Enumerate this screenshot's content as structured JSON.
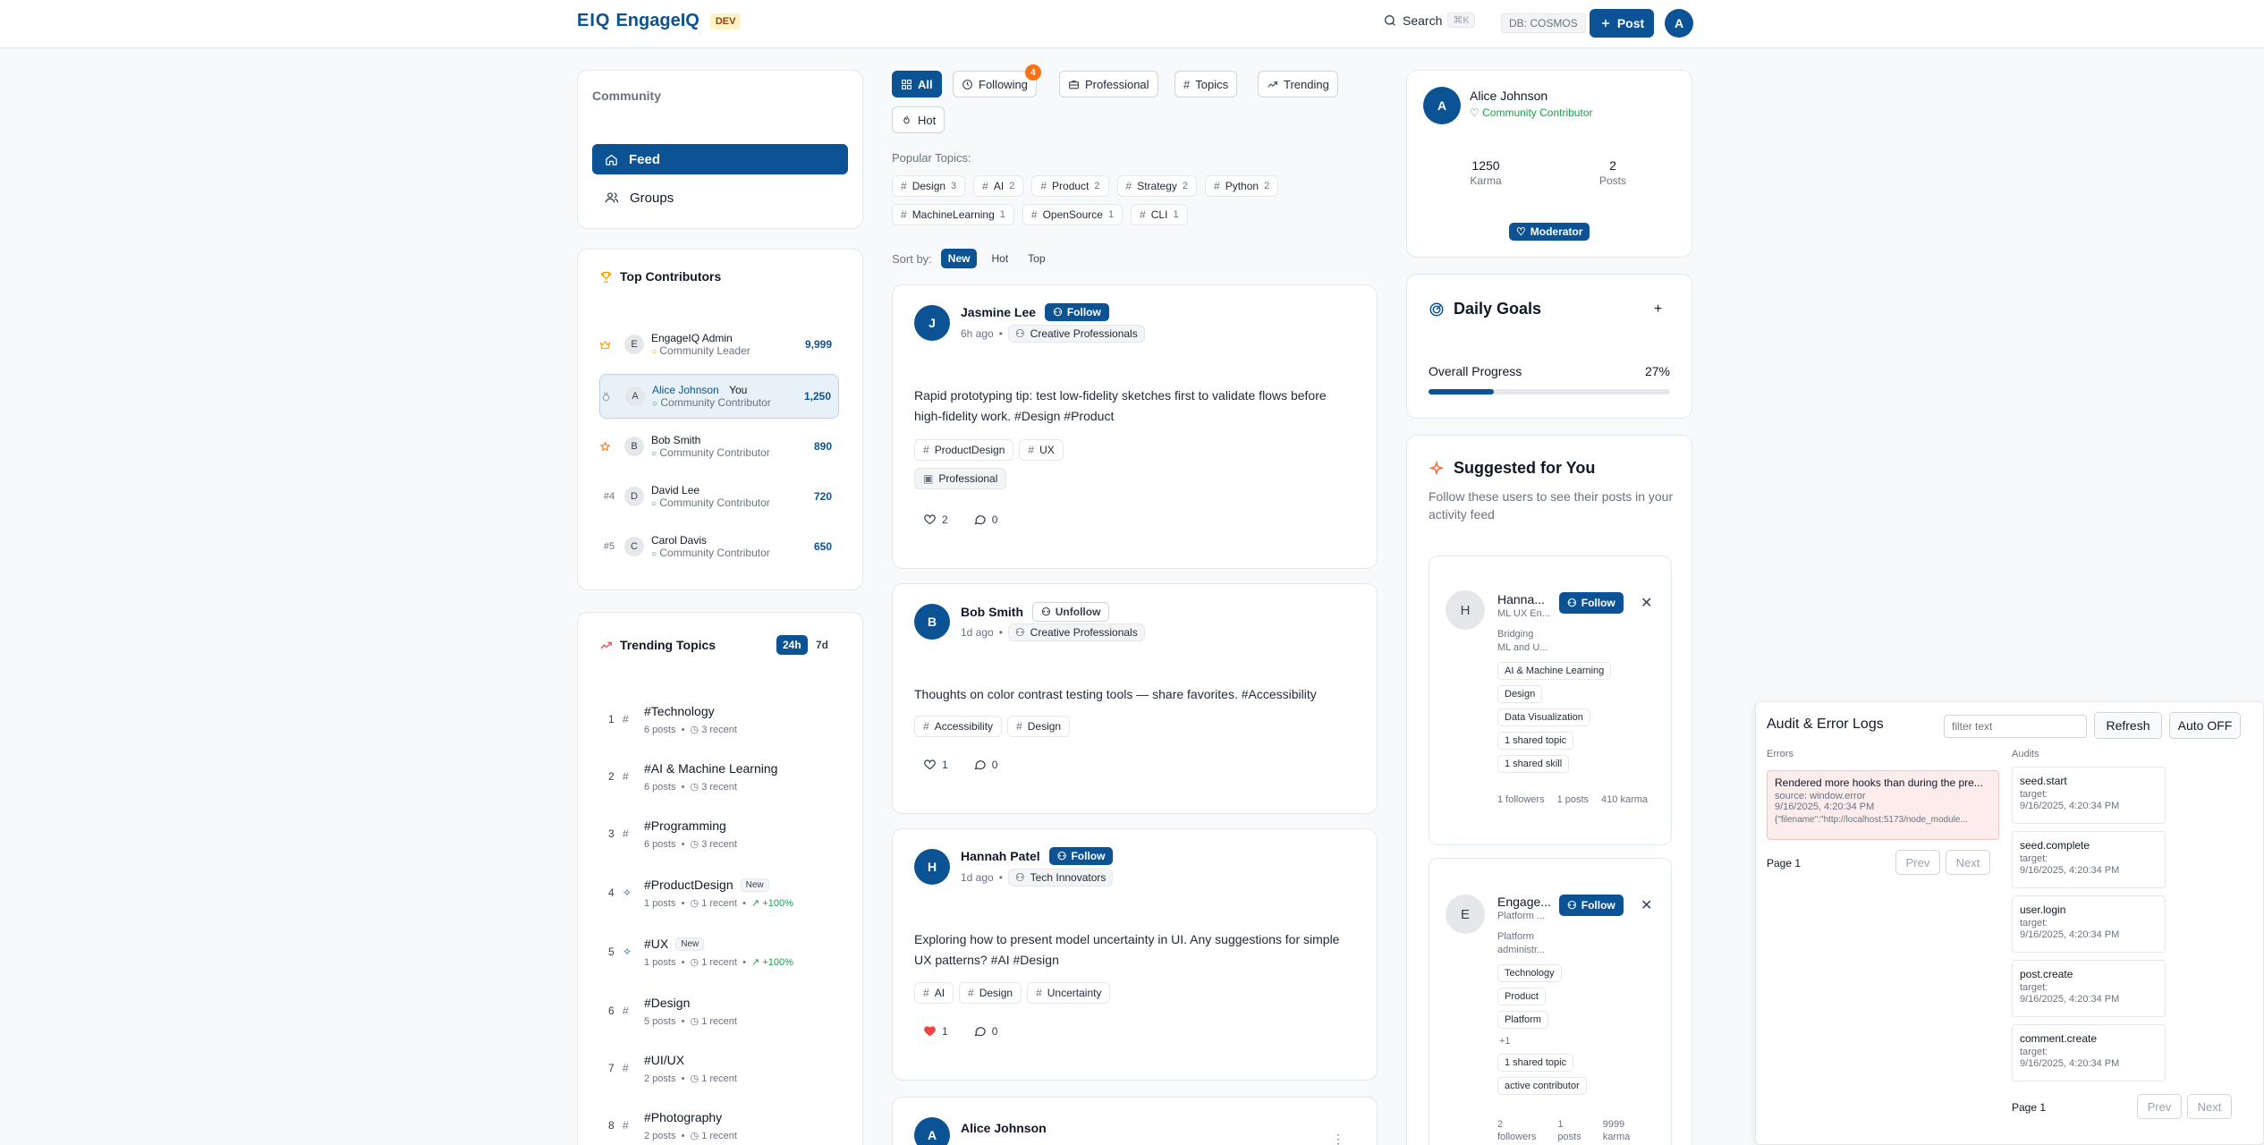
{
  "header": {
    "logo_mark": "EIQ",
    "logo_text": "EngageIQ",
    "env_badge": "DEV",
    "search_label": "Search",
    "search_shortcut": "⌘K",
    "db_tag": "DB: COSMOS",
    "post_label": "Post",
    "avatar_initial": "A"
  },
  "sidebar": {
    "section_title": "Community",
    "nav": [
      {
        "label": "Feed",
        "icon": "home-icon",
        "active": true
      },
      {
        "label": "Groups",
        "icon": "users-icon",
        "active": false
      }
    ]
  },
  "top_contributors": {
    "title": "Top Contributors",
    "items": [
      {
        "rank": "",
        "rank_icon": "crown-icon",
        "initial": "E",
        "name": "EngageIQ Admin",
        "you": "",
        "role": "Community Leader",
        "score": "9,999"
      },
      {
        "rank": "",
        "rank_icon": "medal-icon",
        "initial": "A",
        "name": "Alice Johnson",
        "you": "You",
        "role": "Community Contributor",
        "score": "1,250"
      },
      {
        "rank": "",
        "rank_icon": "award-icon",
        "initial": "B",
        "name": "Bob Smith",
        "you": "",
        "role": "Community Contributor",
        "score": "890"
      },
      {
        "rank": "#4",
        "rank_icon": "",
        "initial": "D",
        "name": "David Lee",
        "you": "",
        "role": "Community Contributor",
        "score": "720"
      },
      {
        "rank": "#5",
        "rank_icon": "",
        "initial": "C",
        "name": "Carol Davis",
        "you": "",
        "role": "Community Contributor",
        "score": "650"
      }
    ]
  },
  "trending": {
    "title": "Trending Topics",
    "range_active": "24h",
    "range_other": "7d",
    "items": [
      {
        "num": "1",
        "title": "#Technology",
        "badge": "",
        "posts": "6 posts",
        "recent": "3 recent",
        "growth": ""
      },
      {
        "num": "2",
        "title": "#AI & Machine Learning",
        "badge": "",
        "posts": "6 posts",
        "recent": "3 recent",
        "growth": ""
      },
      {
        "num": "3",
        "title": "#Programming",
        "badge": "",
        "posts": "6 posts",
        "recent": "3 recent",
        "growth": ""
      },
      {
        "num": "4",
        "title": "#ProductDesign",
        "badge": "New",
        "posts": "1 posts",
        "recent": "1 recent",
        "growth": "+100%"
      },
      {
        "num": "5",
        "title": "#UX",
        "badge": "New",
        "posts": "1 posts",
        "recent": "1 recent",
        "growth": "+100%"
      },
      {
        "num": "6",
        "title": "#Design",
        "badge": "",
        "posts": "5 posts",
        "recent": "1 recent",
        "growth": ""
      },
      {
        "num": "7",
        "title": "#UI/UX",
        "badge": "",
        "posts": "2 posts",
        "recent": "1 recent",
        "growth": ""
      },
      {
        "num": "8",
        "title": "#Photography",
        "badge": "",
        "posts": "2 posts",
        "recent": "1 recent",
        "growth": ""
      }
    ]
  },
  "feed_filters": {
    "tabs": [
      {
        "label": "All",
        "icon": "grid-icon",
        "active": true,
        "badge": ""
      },
      {
        "label": "Following",
        "icon": "clock-icon",
        "active": false,
        "badge": "4"
      },
      {
        "label": "Professional",
        "icon": "briefcase-icon",
        "active": false,
        "badge": ""
      },
      {
        "label": "Topics",
        "icon": "hash-icon",
        "active": false,
        "badge": ""
      },
      {
        "label": "Trending",
        "icon": "trending-icon",
        "active": false,
        "badge": ""
      },
      {
        "label": "Hot",
        "icon": "flame-icon",
        "active": false,
        "badge": ""
      }
    ],
    "popular_label": "Popular Topics:",
    "popular_topics": [
      {
        "label": "Design",
        "count": "3"
      },
      {
        "label": "AI",
        "count": "2"
      },
      {
        "label": "Product",
        "count": "2"
      },
      {
        "label": "Strategy",
        "count": "2"
      },
      {
        "label": "Python",
        "count": "2"
      },
      {
        "label": "MachineLearning",
        "count": "1"
      },
      {
        "label": "OpenSource",
        "count": "1"
      },
      {
        "label": "CLI",
        "count": "1"
      }
    ],
    "sort_label": "Sort by:",
    "sort_options": [
      "New",
      "Hot",
      "Top"
    ],
    "sort_active": "New"
  },
  "posts": [
    {
      "initial": "J",
      "author": "Jasmine Lee",
      "follow_label": "Follow",
      "following": false,
      "time": "6h ago",
      "group": "Creative Professionals",
      "body": "Rapid prototyping tip: test low-fidelity sketches first to validate flows before high-fidelity work. #Design #Product",
      "tags": [
        "ProductDesign",
        "UX"
      ],
      "extra_tag": "Professional",
      "likes": "2",
      "comments": "0",
      "liked": false
    },
    {
      "initial": "B",
      "author": "Bob Smith",
      "follow_label": "Unfollow",
      "following": true,
      "time": "1d ago",
      "group": "Creative Professionals",
      "body": "Thoughts on color contrast testing tools — share favorites. #Accessibility",
      "tags": [
        "Accessibility",
        "Design"
      ],
      "extra_tag": "",
      "likes": "1",
      "comments": "0",
      "liked": false
    },
    {
      "initial": "H",
      "author": "Hannah Patel",
      "follow_label": "Follow",
      "following": false,
      "time": "1d ago",
      "group": "Tech Innovators",
      "body": "Exploring how to present model uncertainty in UI. Any suggestions for simple UX patterns? #AI #Design",
      "tags": [
        "AI",
        "Design",
        "Uncertainty"
      ],
      "extra_tag": "",
      "likes": "1",
      "comments": "0",
      "liked": true
    },
    {
      "initial": "A",
      "author": "Alice Johnson",
      "follow_label": "",
      "following": false,
      "time": "",
      "group": "",
      "body": "",
      "tags": [],
      "extra_tag": "",
      "likes": "",
      "comments": "",
      "liked": false
    }
  ],
  "profile": {
    "initial": "A",
    "name": "Alice Johnson",
    "role": "Community Contributor",
    "karma_value": "1250",
    "karma_label": "Karma",
    "posts_value": "2",
    "posts_label": "Posts",
    "badge": "Moderator"
  },
  "daily_goals": {
    "title": "Daily Goals",
    "add_label": "+",
    "progress_label": "Overall Progress",
    "progress_text": "27%",
    "progress_value": 27
  },
  "suggested": {
    "title": "Suggested for You",
    "subtitle": "Follow these users to see their posts in your activity feed",
    "follow_label": "Follow",
    "users": [
      {
        "initial": "H",
        "name": "Hanna...",
        "title": "ML UX En...",
        "bio_line1": "Bridging",
        "bio_line2": "ML and U...",
        "chips": [
          "AI & Machine Learning",
          "Design",
          "Data Visualization"
        ],
        "more": "",
        "reasons": [
          "1 shared topic",
          "1 shared skill"
        ],
        "followers": "1 followers",
        "posts": "1 posts",
        "karma": "410 karma"
      },
      {
        "initial": "E",
        "name": "Engage...",
        "title": "Platform ...",
        "bio_line1": "Platform",
        "bio_line2": "administr...",
        "chips": [
          "Technology",
          "Product",
          "Platform"
        ],
        "more": "+1",
        "reasons": [
          "1 shared topic",
          "active contributor"
        ],
        "followers": "2",
        "followers2": "followers",
        "posts": "1",
        "posts2": "posts",
        "karma": "9999",
        "karma2": "karma"
      }
    ]
  },
  "audit": {
    "title": "Audit & Error Logs",
    "filter_placeholder": "filter text",
    "refresh_label": "Refresh",
    "auto_label": "Auto OFF",
    "errors_label": "Errors",
    "audits_label": "Audits",
    "error": {
      "title": "Rendered more hooks than during the pre...",
      "source": "source: window.error",
      "time": "9/16/2025, 4:20:34 PM",
      "detail": "{\"filename\":\"http://localhost:5173/node_module..."
    },
    "errors_page": "Page 1",
    "audits_page": "Page 1",
    "prev_label": "Prev",
    "next_label": "Next",
    "audits": [
      {
        "title": "seed.start",
        "target": "target:",
        "time": "9/16/2025, 4:20:34 PM"
      },
      {
        "title": "seed.complete",
        "target": "target:",
        "time": "9/16/2025, 4:20:34 PM"
      },
      {
        "title": "user.login",
        "target": "target:",
        "time": "9/16/2025, 4:20:34 PM"
      },
      {
        "title": "post.create",
        "target": "target:",
        "time": "9/16/2025, 4:20:34 PM"
      },
      {
        "title": "comment.create",
        "target": "target:",
        "time": "9/16/2025, 4:20:34 PM"
      }
    ]
  }
}
